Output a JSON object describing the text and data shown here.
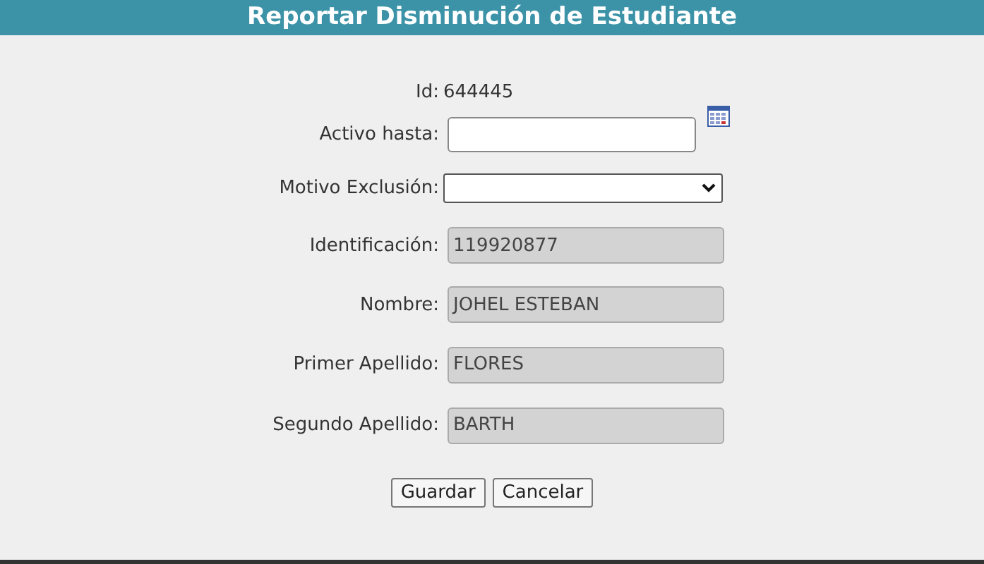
{
  "window": {
    "title": "Reportar Disminución de Estudiante"
  },
  "id": {
    "label": "Id:",
    "value": "644445"
  },
  "fields": [
    {
      "kind": "date",
      "label": "Activo hasta:"
    },
    {
      "kind": "select",
      "label": "Motivo Exclusión:"
    },
    {
      "kind": "readonly",
      "label": "Identificación:",
      "value": "119920877"
    },
    {
      "kind": "readonly",
      "label": "Nombre:",
      "value": "JOHEL ESTEBAN"
    },
    {
      "kind": "readonly",
      "label": "Primer Apellido:",
      "value": "FLORES"
    },
    {
      "kind": "readonly",
      "label": "Segundo Apellido:",
      "value": "BARTH"
    }
  ],
  "buttons": [
    "Guardar",
    "Cancelar"
  ]
}
